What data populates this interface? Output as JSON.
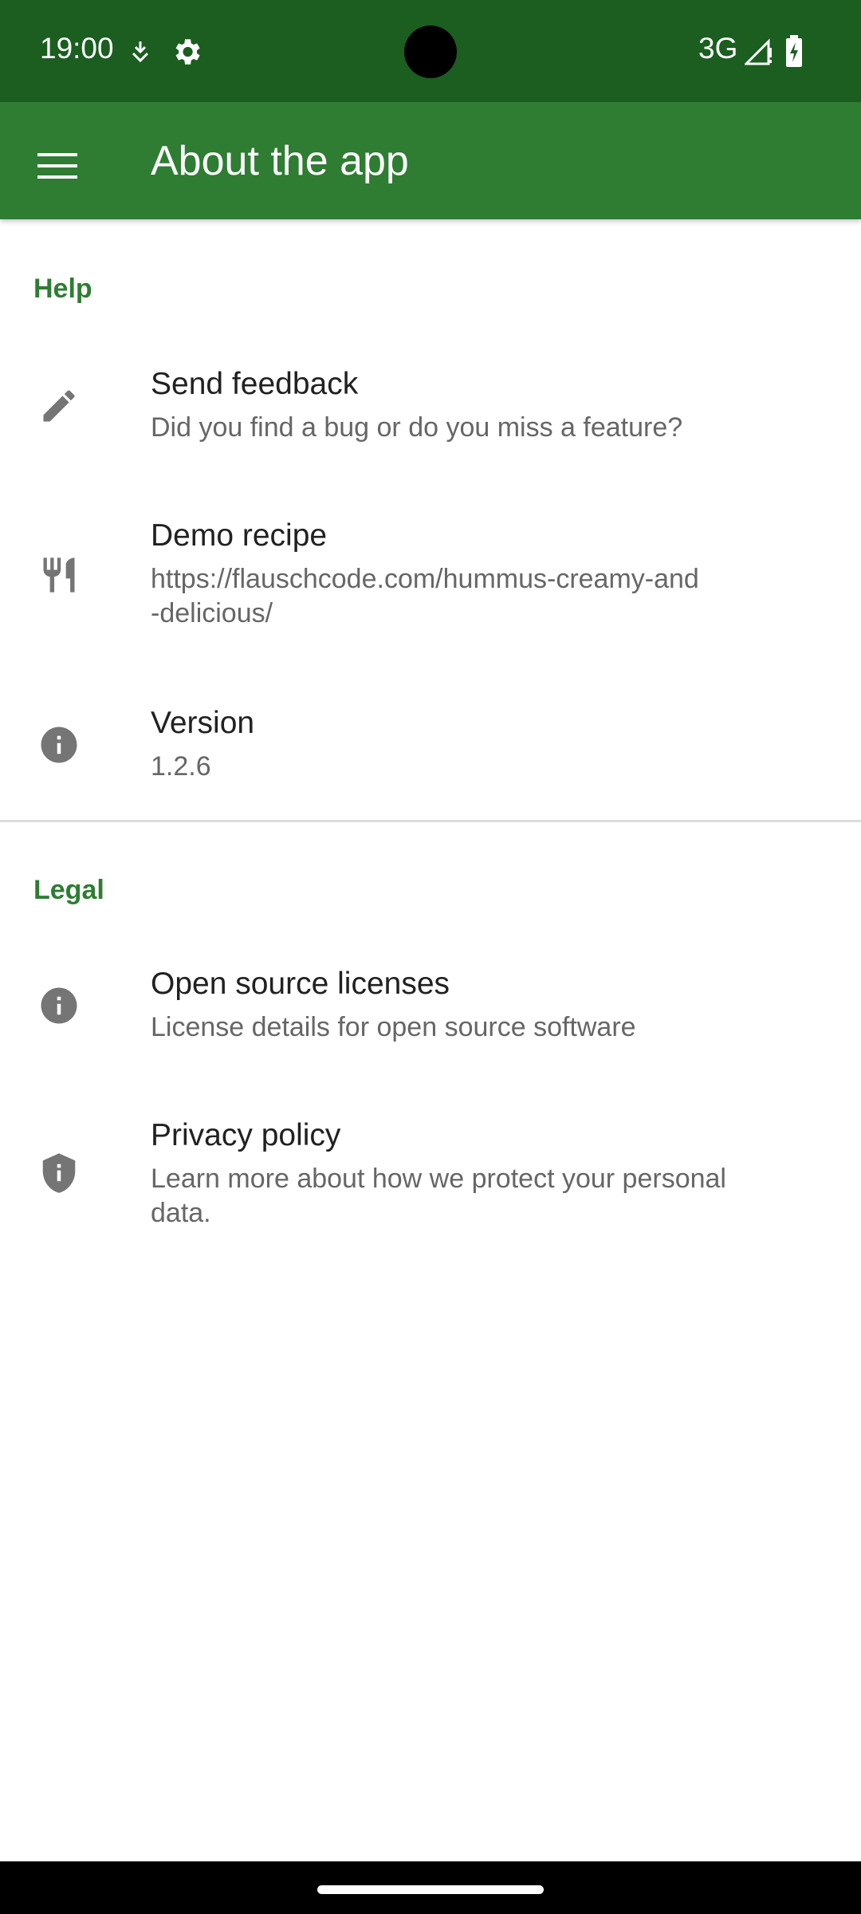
{
  "status_bar": {
    "time": "19:00",
    "network": "3G",
    "icons": [
      "download-icon",
      "settings-icon",
      "signal-icon",
      "battery-charging-icon"
    ]
  },
  "app_bar": {
    "title": "About the app",
    "menu_icon": "hamburger-menu-icon"
  },
  "sections": [
    {
      "header": "Help",
      "items": [
        {
          "title": "Send feedback",
          "summary": "Did you find a bug or do you miss a feature?",
          "icon": "pencil-icon"
        },
        {
          "title": "Demo recipe",
          "summary_line1": "https://flauschcode.com/hummus-creamy-and",
          "summary_line2": "-delicious/",
          "icon": "restaurant-icon"
        },
        {
          "title": "Version",
          "summary": "1.2.6",
          "icon": "info-icon"
        }
      ]
    },
    {
      "header": "Legal",
      "items": [
        {
          "title": "Open source licenses",
          "summary": "License details for open source software",
          "icon": "info-icon"
        },
        {
          "title": "Privacy policy",
          "summary_line1": "Learn more about how we protect your personal",
          "summary_line2": "data.",
          "icon": "shield-icon"
        }
      ]
    }
  ],
  "colors": {
    "status_bar": "#1b5e20",
    "app_bar": "#2e7d32",
    "accent": "#2e7d32",
    "icon_gray": "#757575"
  }
}
